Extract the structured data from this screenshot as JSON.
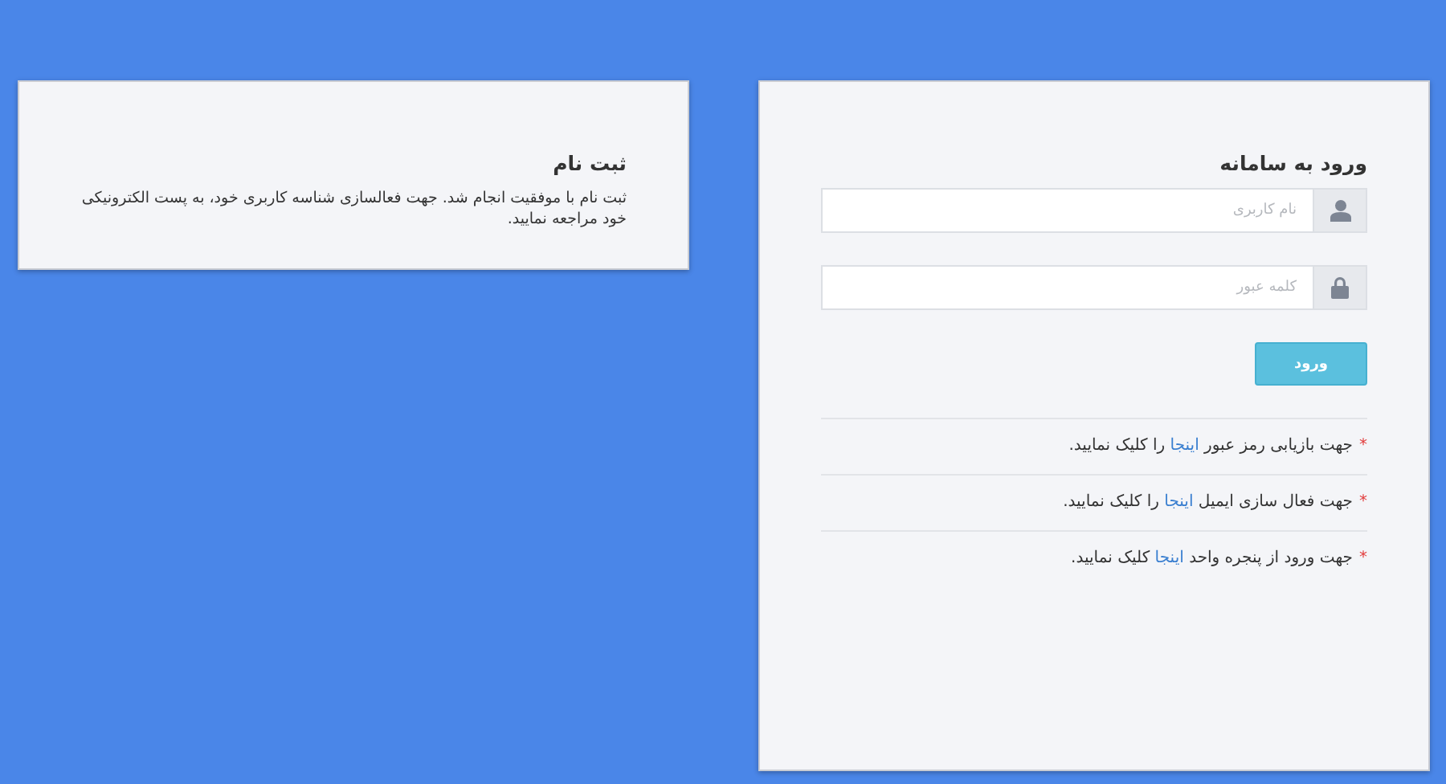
{
  "signup": {
    "title": "ثبت نام",
    "message": "ثبت نام با موفقیت انجام شد. جهت فعالسازی شناسه کاربری خود، به پست الکترونیکی خود مراجعه نمایید."
  },
  "login": {
    "title": "ورود به سامانه",
    "fields": [
      {
        "kind": "user",
        "placeholder": "نام کاربری"
      },
      {
        "kind": "lock",
        "placeholder": "کلمه عبور"
      }
    ],
    "submit": "ورود",
    "help": [
      {
        "mark": "*",
        "before": "جهت بازیابی رمز عبور",
        "link": "اینجا",
        "after": "را کلیک نمایید."
      },
      {
        "mark": "*",
        "before": "جهت فعال سازی ایمیل",
        "link": "اینجا",
        "after": "را کلیک نمایید."
      },
      {
        "mark": "*",
        "before": "جهت ورود از پنجره واحد",
        "link": "اینجا",
        "after": "کلیک نمایید."
      }
    ]
  }
}
